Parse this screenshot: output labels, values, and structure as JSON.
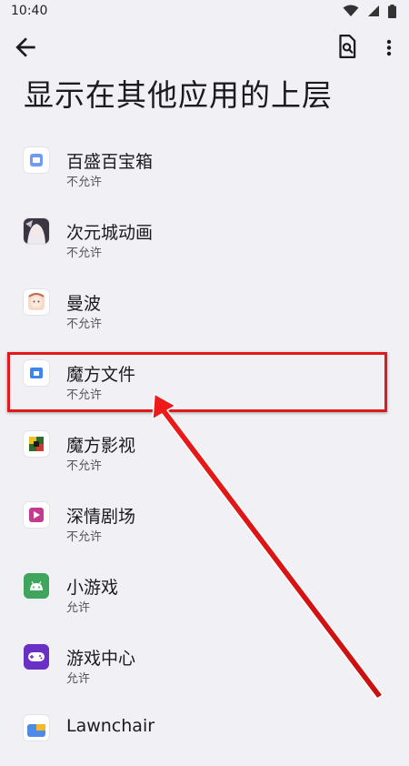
{
  "status_bar": {
    "time": "10:40"
  },
  "page": {
    "title": "显示在其他应用的上层"
  },
  "apps": [
    {
      "name": "百盛百宝箱",
      "status": "不允许",
      "icon": "baisheng-toolbox-icon"
    },
    {
      "name": "次元城动画",
      "status": "不允许",
      "icon": "ciyuancheng-anime-icon"
    },
    {
      "name": "曼波",
      "status": "不允许",
      "icon": "manbo-icon"
    },
    {
      "name": "魔方文件",
      "status": "不允许",
      "icon": "mofang-files-icon"
    },
    {
      "name": "魔方影视",
      "status": "不允许",
      "icon": "mofang-video-icon"
    },
    {
      "name": "深情剧场",
      "status": "不允许",
      "icon": "shenqing-theater-icon"
    },
    {
      "name": "小游戏",
      "status": "允许",
      "icon": "android-game-icon"
    },
    {
      "name": "游戏中心",
      "status": "允许",
      "icon": "game-center-icon"
    },
    {
      "name": "Lawnchair",
      "status": "",
      "icon": "lawnchair-icon"
    }
  ],
  "colors": {
    "background": "#f1f0f5",
    "annotation_red": "#e0191b"
  }
}
